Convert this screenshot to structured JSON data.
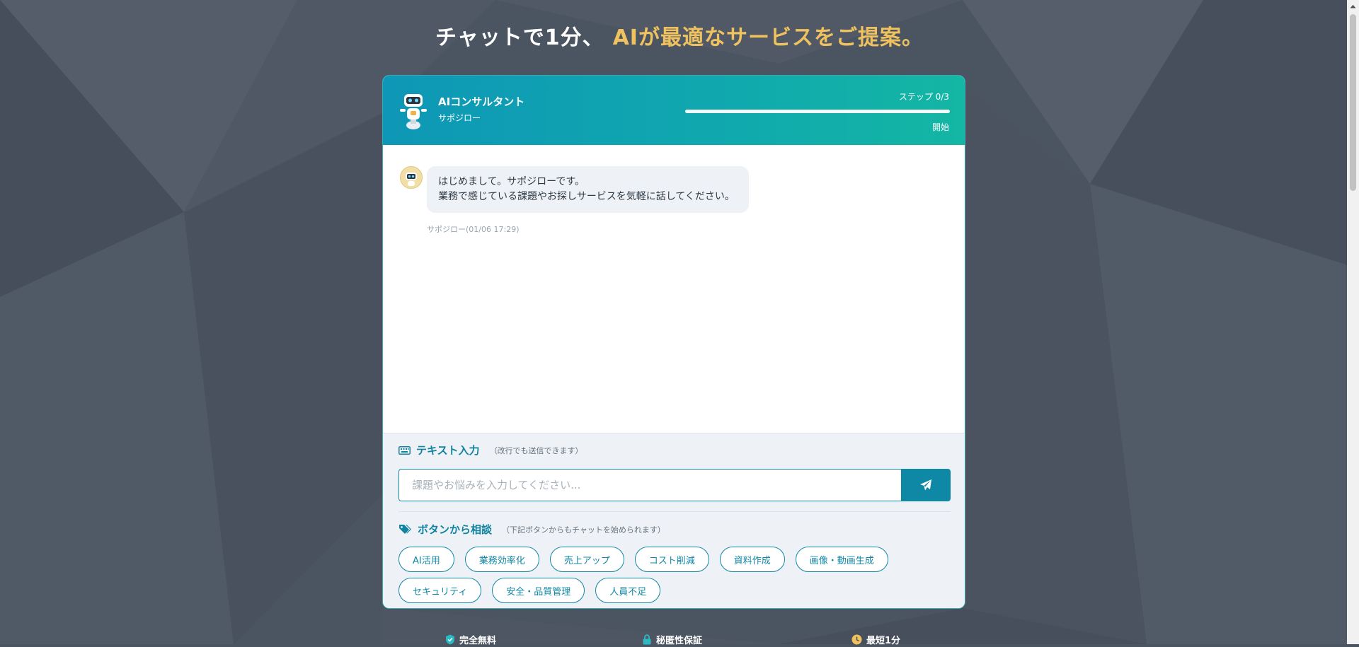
{
  "headline": {
    "part1": "チャットで1分、",
    "part2": "AIが最適なサービスをご提案。"
  },
  "header": {
    "agent_name": "AIコンサルタント",
    "agent_sub": "サポジロー",
    "step_label": "ステップ 0/3",
    "progress_fraction": 0,
    "progress_status": "開始"
  },
  "chat": {
    "messages": [
      {
        "lines": [
          "はじめまして。サポジローです。",
          "業務で感じている課題やお探しサービスを気軽に話してください。"
        ],
        "meta": "サポジロー(01/06 17:29)"
      }
    ]
  },
  "text_input": {
    "title": "テキスト入力",
    "hint": "（改行でも送信できます）",
    "placeholder": "課題やお悩みを入力してください..."
  },
  "button_consult": {
    "title": "ボタンから相談",
    "hint": "（下記ボタンからもチャットを始められます）",
    "chips": [
      "AI活用",
      "業務効率化",
      "売上アップ",
      "コスト削減",
      "資料作成",
      "画像・動画生成",
      "セキュリティ",
      "安全・品質管理",
      "人員不足"
    ]
  },
  "badges": {
    "free": "完全無料",
    "privacy": "秘匿性保証",
    "fast": "最短1分"
  },
  "colors": {
    "accent": "#efc25f",
    "primary": "#1187a3",
    "header_start": "#0e97b6",
    "header_end": "#14b6a4",
    "background": "#4b5461"
  }
}
